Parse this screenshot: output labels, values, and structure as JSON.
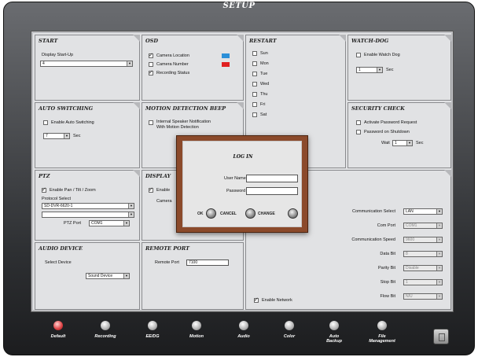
{
  "window": {
    "title": "SETUP"
  },
  "start": {
    "title": "START",
    "display_label": "Display Start-Up",
    "display_value": "4"
  },
  "osd": {
    "title": "OSD",
    "items": [
      "Camera Location",
      "Camera Number",
      "Recording Status"
    ],
    "colors": [
      "#2b8fd8",
      "#e02020"
    ]
  },
  "restart": {
    "title": "RESTART",
    "days": [
      "Sun",
      "Mon",
      "Tue",
      "Wed",
      "Thu",
      "Fri",
      "Sat"
    ]
  },
  "watchdog": {
    "title": "WATCH-DOG",
    "enable_label": "Enable Watch Dog",
    "value": "1",
    "unit": "Sec"
  },
  "auto_switching": {
    "title": "AUTO SWITCHING",
    "enable_label": "Enable Auto Switching",
    "value": "7",
    "unit": "Sec"
  },
  "motion_beep": {
    "title": "MOTION DETECTION BEEP",
    "line1": "Internal Speaker Notification",
    "line2": "With Motion Detection"
  },
  "security": {
    "title": "SECURITY CHECK",
    "item1": "Activate Password Request",
    "item2": "Password on Shutdown",
    "wait_label": "Wait",
    "wait_value": "1",
    "unit": "Sec"
  },
  "ptz": {
    "title": "PTZ",
    "enable_label": "Enable Pan / Tilt / Zoom",
    "protocol_label": "Protocol Select",
    "protocol_value": "SD-DVR-6620-1",
    "port_label": "PTZ Port",
    "port_value": "COM1"
  },
  "display": {
    "title": "DISPLAY",
    "enable_label": "Enable",
    "camera_label": "Camera"
  },
  "audio": {
    "title": "AUDIO DEVICE",
    "select_label": "Select Device",
    "device_value": "Sound Device"
  },
  "remote": {
    "title": "REMOTE PORT",
    "port_label": "Remote Port",
    "port_value": "7100"
  },
  "network": {
    "enable_label": "Enable Network",
    "rows": [
      {
        "label": "Communication Select",
        "value": "LAN"
      },
      {
        "label": "Com Port",
        "value": "COM1"
      },
      {
        "label": "Communication Speed",
        "value": "9600"
      },
      {
        "label": "Data Bit",
        "value": "8"
      },
      {
        "label": "Parity Bit",
        "value": "Disable"
      },
      {
        "label": "Stop Bit",
        "value": "1"
      },
      {
        "label": "Flow Bit",
        "value": "N/U"
      }
    ]
  },
  "login": {
    "title": "LOG IN",
    "username_label": "User Name",
    "password_label": "Password",
    "ok": "OK",
    "cancel": "CANCEL",
    "change": "CHANGE"
  },
  "toolbar": {
    "items": [
      {
        "label": "Default"
      },
      {
        "label": "Recording"
      },
      {
        "label": "EE/DG"
      },
      {
        "label": "Motion"
      },
      {
        "label": "Audio"
      },
      {
        "label": "Color"
      },
      {
        "label": "Auto Backup"
      },
      {
        "label": "File Management"
      }
    ]
  }
}
